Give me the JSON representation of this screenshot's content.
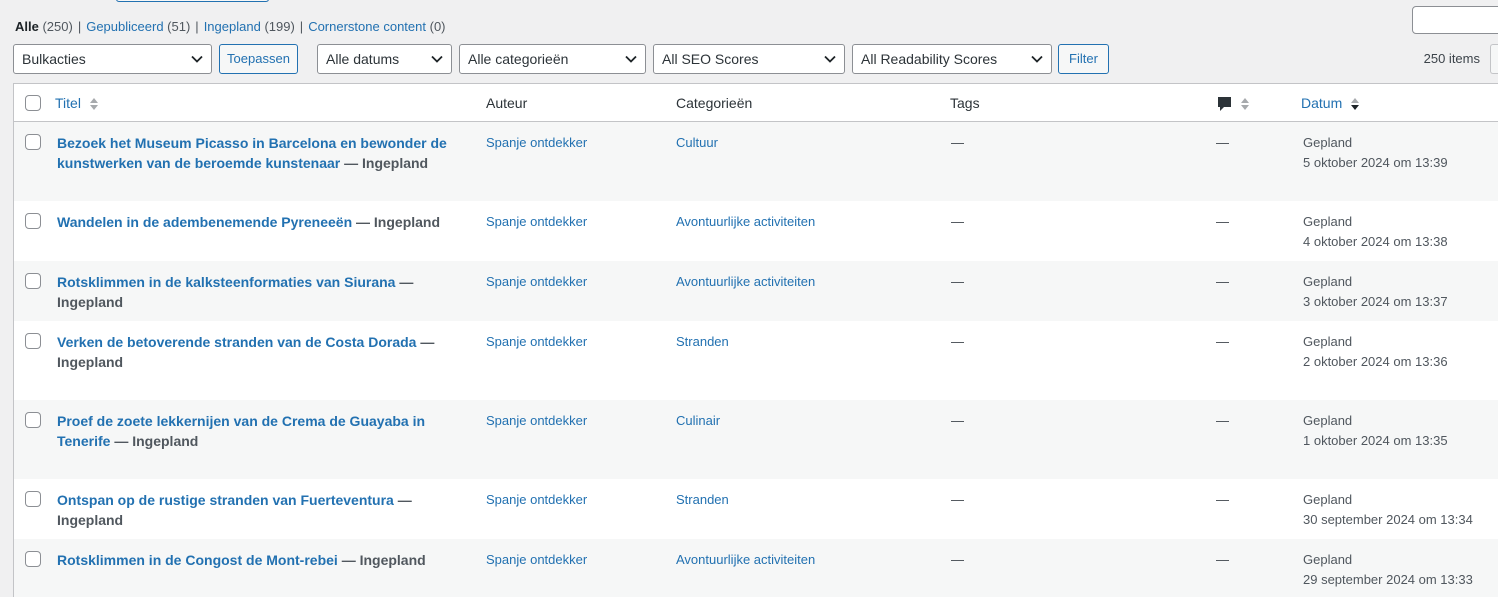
{
  "views": [
    {
      "label": "Alle",
      "count": "(250)",
      "current": true
    },
    {
      "label": "Gepubliceerd",
      "count": "(51)",
      "current": false
    },
    {
      "label": "Ingepland",
      "count": "(199)",
      "current": false
    },
    {
      "label": "Cornerstone content",
      "count": "(0)",
      "current": false
    }
  ],
  "separator": "|",
  "toolbar": {
    "bulk_actions": "Bulkacties",
    "apply": "Toepassen",
    "dates": "Alle datums",
    "categories": "Alle categorieën",
    "seo": "All SEO Scores",
    "readability": "All Readability Scores",
    "filter": "Filter",
    "items_count": "250 items"
  },
  "columns": {
    "title": "Titel",
    "author": "Auteur",
    "categories": "Categorieën",
    "tags": "Tags",
    "comments_icon": "comment-icon",
    "date": "Datum"
  },
  "rows": [
    {
      "title": "Bezoek het Museum Picasso in Barcelona en bewonder de kunstwerken van de beroemde kunstenaar",
      "state": "— Ingepland",
      "author": "Spanje ontdekker",
      "category": "Cultuur",
      "tags": "—",
      "comments": "—",
      "date_status": "Gepland",
      "date": "5 oktober 2024 om 13:39"
    },
    {
      "title": "Wandelen in de adembenemende Pyreneeën",
      "state": "— Ingepland",
      "author": "Spanje ontdekker",
      "category": "Avontuurlijke activiteiten",
      "tags": "—",
      "comments": "—",
      "date_status": "Gepland",
      "date": "4 oktober 2024 om 13:38"
    },
    {
      "title": "Rotsklimmen in de kalksteenformaties van Siurana",
      "state": "— Ingepland",
      "author": "Spanje ontdekker",
      "category": "Avontuurlijke activiteiten",
      "tags": "—",
      "comments": "—",
      "date_status": "Gepland",
      "date": "3 oktober 2024 om 13:37"
    },
    {
      "title": "Verken de betoverende stranden van de Costa Dorada",
      "state": "— Ingepland",
      "author": "Spanje ontdekker",
      "category": "Stranden",
      "tags": "—",
      "comments": "—",
      "date_status": "Gepland",
      "date": "2 oktober 2024 om 13:36"
    },
    {
      "title": "Proef de zoete lekkernijen van de Crema de Guayaba in Tenerife",
      "state": "— Ingepland",
      "author": "Spanje ontdekker",
      "category": "Culinair",
      "tags": "—",
      "comments": "—",
      "date_status": "Gepland",
      "date": "1 oktober 2024 om 13:35"
    },
    {
      "title": "Ontspan op de rustige stranden van Fuerteventura",
      "state": "— Ingepland",
      "author": "Spanje ontdekker",
      "category": "Stranden",
      "tags": "—",
      "comments": "—",
      "date_status": "Gepland",
      "date": "30 september 2024 om 13:34"
    },
    {
      "title": "Rotsklimmen in de Congost de Mont-rebei",
      "state": "— Ingepland",
      "author": "Spanje ontdekker",
      "category": "Avontuurlijke activiteiten",
      "tags": "—",
      "comments": "—",
      "date_status": "Gepland",
      "date": "29 september 2024 om 13:33"
    }
  ]
}
